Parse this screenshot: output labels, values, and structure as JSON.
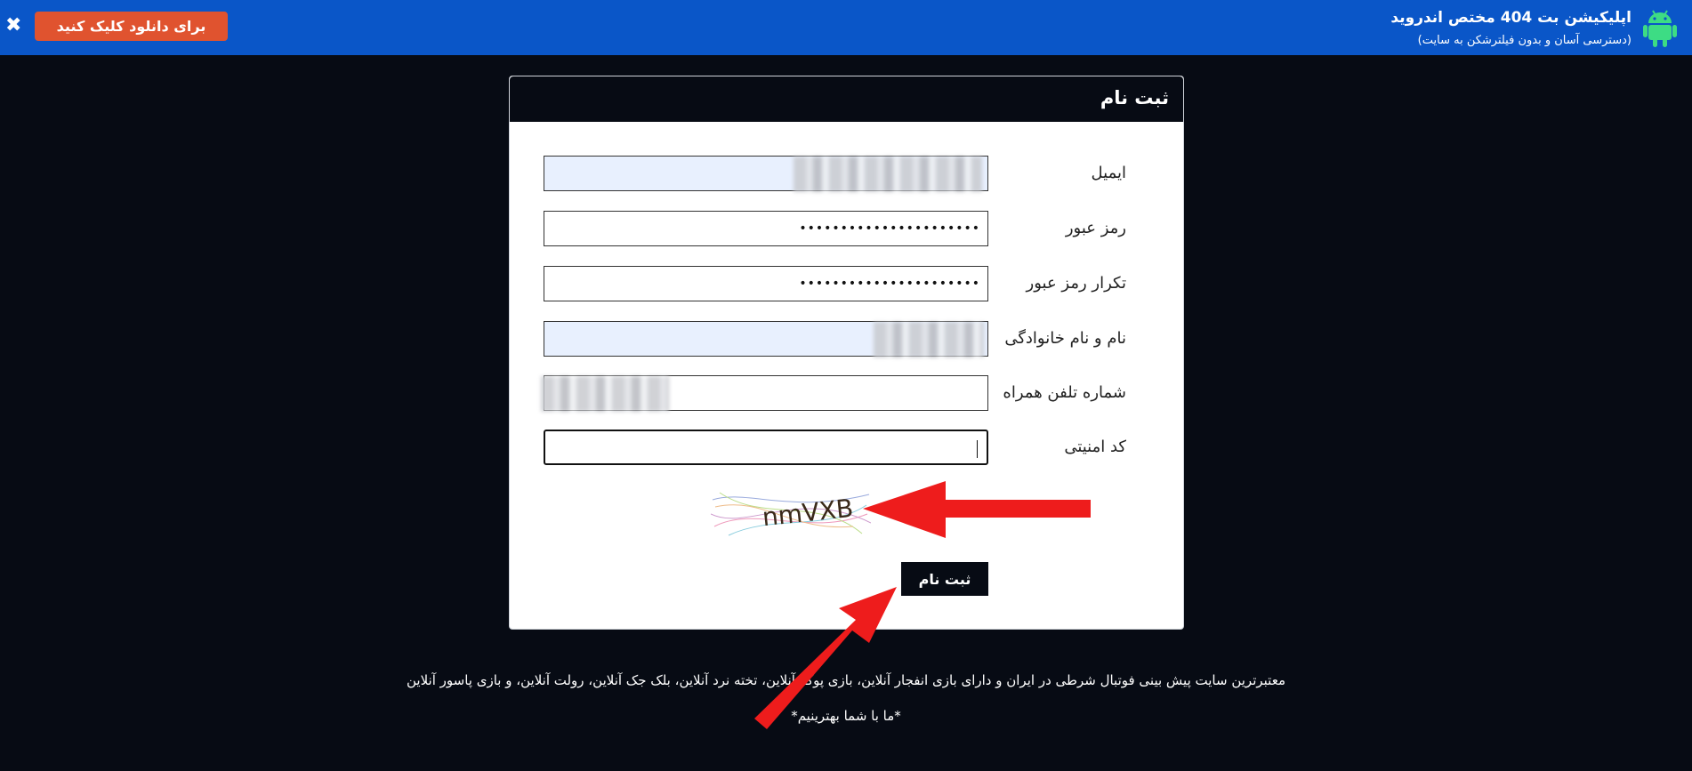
{
  "banner": {
    "title": "اپلیکیشن بت 404 مختص اندروید",
    "subtitle": "(دسترسی آسان و بدون فیلترشکن به سایت)",
    "download_label": "برای دانلود کلیک کنید",
    "close_symbol": "✖",
    "icon": "android-icon",
    "background_color": "#0a56c8",
    "button_color": "#e0532f"
  },
  "form": {
    "title": "ثبت نام",
    "fields": [
      {
        "label": "ایمیل",
        "value": ""
      },
      {
        "label": "رمز عبور",
        "value": "••••••••••••••••••••••"
      },
      {
        "label": "تکرار رمز عبور",
        "value": "••••••••••••••••••••••"
      },
      {
        "label": "نام و نام خانوادگی",
        "value": ""
      },
      {
        "label": "شماره تلفن همراه",
        "value": ""
      },
      {
        "label": "کد امنیتی",
        "value": ""
      }
    ],
    "captcha_text": "nmVXB",
    "submit_label": "ثبت نام"
  },
  "footer": {
    "description": "معتبرترین سایت پیش بینی فوتبال شرطی در ایران و دارای بازی انفجار آنلاین، بازی پوکر آنلاین، تخته نرد آنلاین، بلک جک آنلاین، رولت آنلاین، و بازی پاسور آنلاین",
    "slogan": "*ما با شما بهترینیم*"
  },
  "colors": {
    "page_background": "#070b14",
    "arrow": "#ee1c1c"
  }
}
